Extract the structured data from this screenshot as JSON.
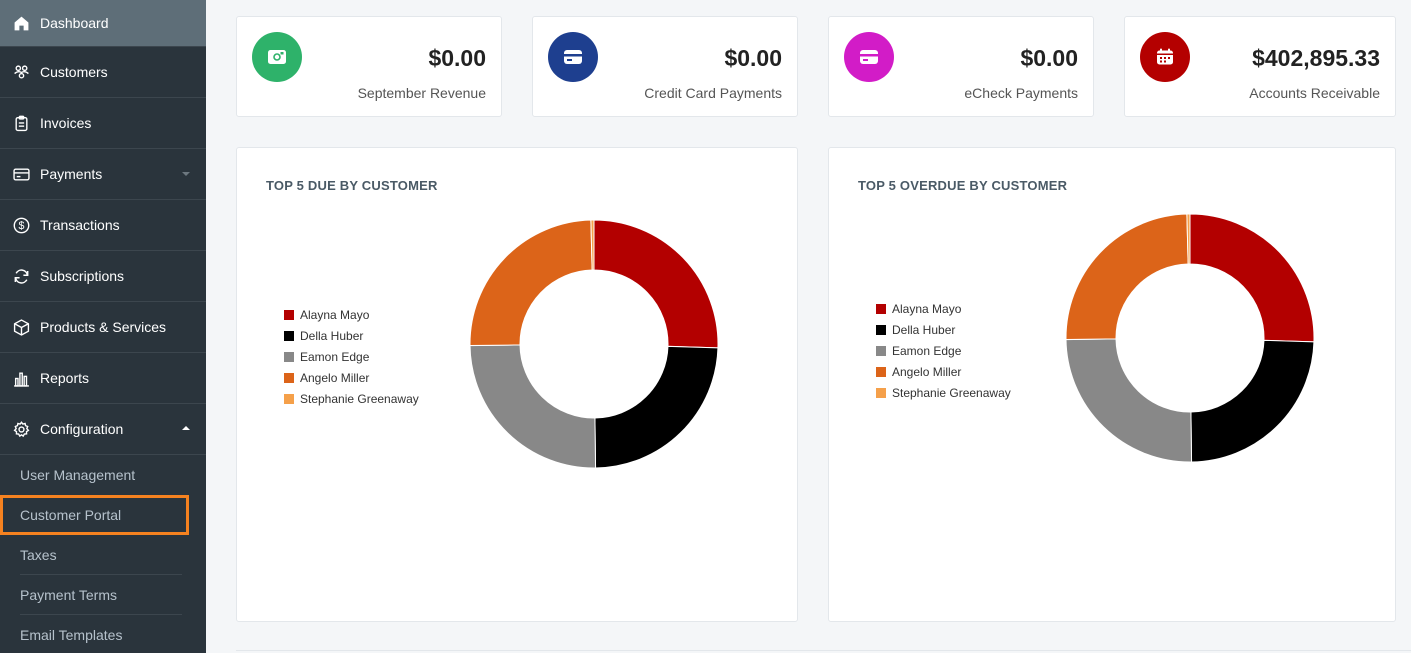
{
  "sidebar": {
    "items": [
      {
        "label": "Dashboard",
        "icon": "home-icon"
      },
      {
        "label": "Customers",
        "icon": "customers-icon"
      },
      {
        "label": "Invoices",
        "icon": "clipboard-icon"
      },
      {
        "label": "Payments",
        "icon": "credit-card-icon"
      },
      {
        "label": "Transactions",
        "icon": "dollar-circle-icon"
      },
      {
        "label": "Subscriptions",
        "icon": "refresh-icon"
      },
      {
        "label": "Products & Services",
        "icon": "box-icon"
      },
      {
        "label": "Reports",
        "icon": "bar-chart-icon"
      },
      {
        "label": "Configuration",
        "icon": "gear-icon"
      }
    ],
    "sub_items": [
      {
        "label": "User Management"
      },
      {
        "label": "Customer Portal"
      },
      {
        "label": "Taxes"
      },
      {
        "label": "Payment Terms"
      },
      {
        "label": "Email Templates"
      }
    ]
  },
  "stats": [
    {
      "amount": "$0.00",
      "label": "September Revenue",
      "color": "#2eb26a",
      "icon": "cash-icon"
    },
    {
      "amount": "$0.00",
      "label": "Credit Card Payments",
      "color": "#1e3f8f",
      "icon": "credit-card-icon"
    },
    {
      "amount": "$0.00",
      "label": "eCheck Payments",
      "color": "#d21cc7",
      "icon": "credit-card-icon"
    },
    {
      "amount": "$402,895.33",
      "label": "Accounts Receivable",
      "color": "#b40000",
      "icon": "calendar-icon"
    }
  ],
  "charts": {
    "due": {
      "title": "TOP 5 DUE BY CUSTOMER"
    },
    "overdue": {
      "title": "TOP 5 OVERDUE BY CUSTOMER"
    }
  },
  "legend_colors": [
    "#b30000",
    "#000000",
    "#888888",
    "#dc6419",
    "#f5a04a"
  ],
  "chart_data": [
    {
      "type": "pie",
      "title": "TOP 5 DUE BY CUSTOMER",
      "categories": [
        "Alayna Mayo",
        "Della Huber",
        "Eamon Edge",
        "Angelo Miller",
        "Stephanie Greenaway"
      ],
      "values": [
        25.5,
        24.3,
        25.0,
        24.8,
        0.4
      ],
      "colors": [
        "#b30000",
        "#000000",
        "#888888",
        "#dc6419",
        "#f5a04a"
      ],
      "legend_position": "left"
    },
    {
      "type": "pie",
      "title": "TOP 5 OVERDUE BY CUSTOMER",
      "categories": [
        "Alayna Mayo",
        "Della Huber",
        "Eamon Edge",
        "Angelo Miller",
        "Stephanie Greenaway"
      ],
      "values": [
        25.5,
        24.3,
        25.0,
        24.8,
        0.4
      ],
      "colors": [
        "#b30000",
        "#000000",
        "#888888",
        "#dc6419",
        "#f5a04a"
      ],
      "legend_position": "left"
    }
  ]
}
